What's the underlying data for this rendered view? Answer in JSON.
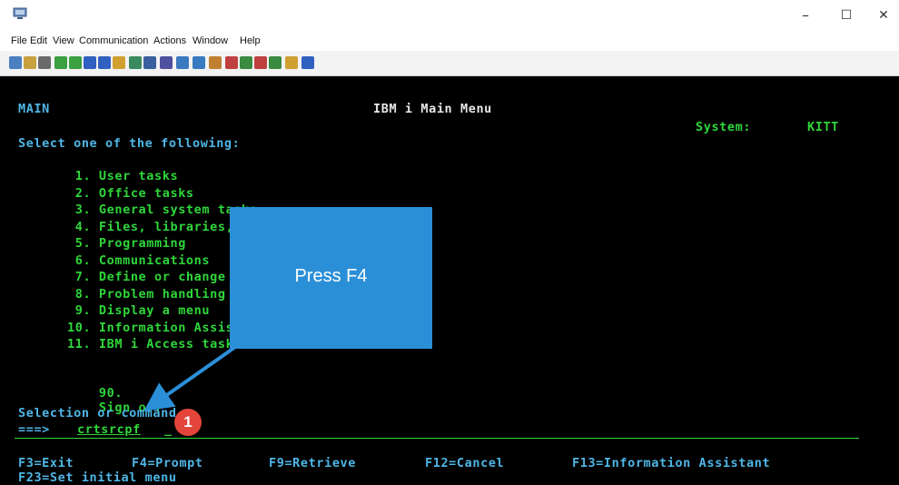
{
  "window": {
    "controls": {
      "minimize": "–",
      "maximize": "☐",
      "close": "✕"
    }
  },
  "menu": [
    "File",
    "Edit",
    "View",
    "Communication",
    "Actions",
    "Window",
    "Help"
  ],
  "toolbar_icons": [
    {
      "name": "copy-icon",
      "color": "#4a7fc0"
    },
    {
      "name": "paste-icon",
      "color": "#c8a040"
    },
    {
      "name": "print-icon",
      "color": "#6a6a6a"
    },
    {
      "name": "send-icon",
      "color": "#3aa040"
    },
    {
      "name": "receive-icon",
      "color": "#3aa040"
    },
    {
      "name": "display-icon",
      "color": "#3060c0"
    },
    {
      "name": "clock-icon",
      "color": "#3060c0"
    },
    {
      "name": "macro-icon",
      "color": "#d0a030"
    },
    {
      "name": "play-icon",
      "color": "#3a8a60"
    },
    {
      "name": "stop-icon",
      "color": "#3a60a0"
    },
    {
      "name": "keyboard-icon",
      "color": "#5050a0"
    },
    {
      "name": "screen-icon",
      "color": "#3a7ac0"
    },
    {
      "name": "popup-icon",
      "color": "#3a7ac0"
    },
    {
      "name": "settings-icon",
      "color": "#c08030"
    },
    {
      "name": "chart-icon",
      "color": "#c04040"
    },
    {
      "name": "chart2-icon",
      "color": "#3a8a40"
    },
    {
      "name": "chart3-icon",
      "color": "#c04040"
    },
    {
      "name": "chart4-icon",
      "color": "#3a8a40"
    },
    {
      "name": "doc-icon",
      "color": "#d0a030"
    },
    {
      "name": "help-icon",
      "color": "#3060c0"
    }
  ],
  "terminal": {
    "screen_id": "MAIN",
    "title": "IBM i Main Menu",
    "system_label": "System:",
    "system_name": "KITT",
    "prompt": "Select one of the following:",
    "options": [
      {
        "num": " 1.",
        "text": "User tasks"
      },
      {
        "num": " 2.",
        "text": "Office tasks"
      },
      {
        "num": " 3.",
        "text": "General system tasks"
      },
      {
        "num": " 4.",
        "text": "Files, libraries, and folders"
      },
      {
        "num": " 5.",
        "text": "Programming"
      },
      {
        "num": " 6.",
        "text": "Communications"
      },
      {
        "num": " 7.",
        "text": "Define or change the system"
      },
      {
        "num": " 8.",
        "text": "Problem handling"
      },
      {
        "num": " 9.",
        "text": "Display a menu"
      },
      {
        "num": "10.",
        "text": "Information Assistant options"
      },
      {
        "num": "11.",
        "text": "IBM i Access tasks"
      }
    ],
    "signoff": {
      "num": "90.",
      "text": "Sign off"
    },
    "selection_label": "Selection or command",
    "cmd_arrow": "===>",
    "cmd_value": "crtsrcpf",
    "fkeys_row1": [
      {
        "key": "F3=Exit"
      },
      {
        "key": "F4=Prompt"
      },
      {
        "key": "F9=Retrieve"
      },
      {
        "key": "F12=Cancel"
      },
      {
        "key": "F13=Information Assistant"
      }
    ],
    "fkeys_row2": "F23=Set initial menu"
  },
  "callout": {
    "text": "Press F4",
    "badge": "1",
    "color": "#2b8fd8",
    "badge_color": "#e3453b"
  },
  "colors": {
    "terminal_bg": "#000000",
    "terminal_green": "#2fd63a",
    "terminal_white": "#e8e8e8",
    "terminal_cyan": "#4fb6e6"
  }
}
